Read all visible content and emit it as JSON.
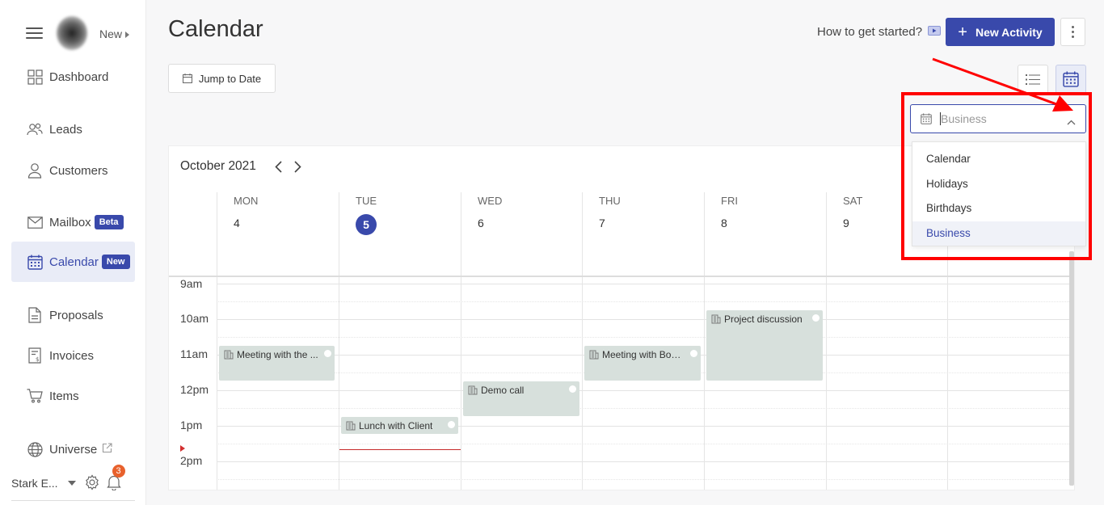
{
  "app": {
    "new_label": "New"
  },
  "sidebar": {
    "items": [
      {
        "label": "Dashboard",
        "icon": "dashboard-icon"
      },
      {
        "label": "Leads",
        "icon": "leads-icon"
      },
      {
        "label": "Customers",
        "icon": "customers-icon"
      },
      {
        "label": "Mailbox",
        "icon": "mailbox-icon",
        "badge": "Beta"
      },
      {
        "label": "Calendar",
        "icon": "calendar-icon",
        "badge": "New",
        "active": true
      },
      {
        "label": "Proposals",
        "icon": "proposals-icon"
      },
      {
        "label": "Invoices",
        "icon": "invoices-icon"
      },
      {
        "label": "Items",
        "icon": "items-icon"
      },
      {
        "label": "Universe",
        "icon": "universe-icon",
        "external": true
      }
    ],
    "footer": {
      "account_name": "Stark E...",
      "notification_count": "3"
    }
  },
  "header": {
    "title": "Calendar",
    "how_to": "How to get started?",
    "new_activity": "New Activity"
  },
  "toolbar": {
    "jump_to_date": "Jump to Date"
  },
  "calendar": {
    "month": "October 2021",
    "days": [
      {
        "name": "MON",
        "num": "4"
      },
      {
        "name": "TUE",
        "num": "5",
        "today": true
      },
      {
        "name": "WED",
        "num": "6"
      },
      {
        "name": "THU",
        "num": "7"
      },
      {
        "name": "FRI",
        "num": "8"
      },
      {
        "name": "SAT",
        "num": "9"
      }
    ],
    "times": [
      "9am",
      "10am",
      "11am",
      "12pm",
      "1pm",
      "2pm"
    ],
    "events": [
      {
        "title": "Meeting with the ...",
        "day": 0,
        "start_hour": 11.0,
        "end_hour": 12.0
      },
      {
        "title": "Lunch with Client",
        "day": 1,
        "start_hour": 13.0,
        "end_hour": 13.5
      },
      {
        "title": "Demo call",
        "day": 2,
        "start_hour": 12.0,
        "end_hour": 13.0
      },
      {
        "title": "Meeting with Boa...",
        "day": 3,
        "start_hour": 11.0,
        "end_hour": 12.0
      },
      {
        "title": "Project discussion",
        "day": 4,
        "start_hour": 10.0,
        "end_hour": 12.0
      }
    ],
    "now_hour": 13.9
  },
  "dropdown": {
    "value": "Business",
    "options": [
      "Calendar",
      "Holidays",
      "Birthdays",
      "Business"
    ],
    "selected": "Business"
  },
  "colors": {
    "accent": "#3949ab",
    "event_bg": "#d7e0dc",
    "annotation": "#ff0000",
    "notification": "#e8612c"
  }
}
